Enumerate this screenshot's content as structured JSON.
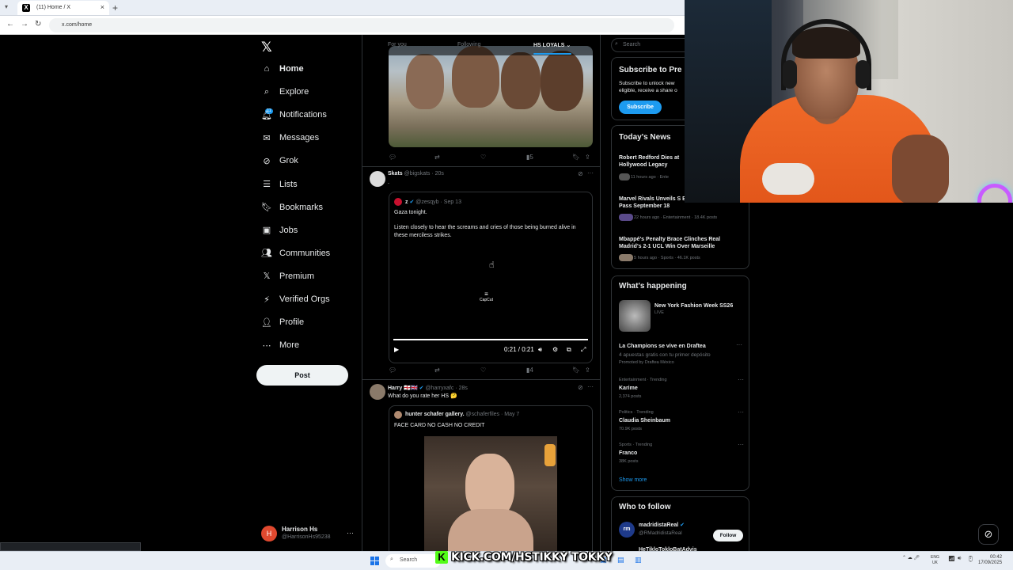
{
  "browser": {
    "tab_title": "(11) Home / X",
    "url": "x.com/home",
    "tab_close": "×",
    "new_tab": "+"
  },
  "nav": {
    "items": [
      {
        "label": "Home",
        "icon": "home-icon"
      },
      {
        "label": "Explore",
        "icon": "search-icon"
      },
      {
        "label": "Notifications",
        "icon": "bell-icon"
      },
      {
        "label": "Messages",
        "icon": "mail-icon"
      },
      {
        "label": "Grok",
        "icon": "grok-icon"
      },
      {
        "label": "Lists",
        "icon": "list-icon"
      },
      {
        "label": "Bookmarks",
        "icon": "bookmark-icon"
      },
      {
        "label": "Jobs",
        "icon": "briefcase-icon"
      },
      {
        "label": "Communities",
        "icon": "people-icon"
      },
      {
        "label": "Premium",
        "icon": "x-icon"
      },
      {
        "label": "Verified Orgs",
        "icon": "bolt-icon"
      },
      {
        "label": "Profile",
        "icon": "person-icon"
      },
      {
        "label": "More",
        "icon": "more-circle-icon"
      }
    ],
    "notif_count": "11",
    "post_label": "Post",
    "profile": {
      "name": "Harrison Hs",
      "handle": "@HarrisonHs95238",
      "initial": "H"
    }
  },
  "feed": {
    "tabs": [
      "For you",
      "Following",
      "HS LOYALS"
    ],
    "post1": {
      "reposts": "",
      "likes": "",
      "views": "5"
    },
    "post2": {
      "name": "Skats",
      "handle": "@bigskats · 20s",
      "text": ".",
      "quote": {
        "name": "z",
        "handle": "@zesqyb · Sep 13",
        "line1": "Gaza tonight.",
        "line2": "Listen closely to hear the screams and cries of those being burned alive in these merciless strikes."
      },
      "video": {
        "watermark": "CapCut",
        "time": "0:21 / 0:21"
      },
      "views": "4"
    },
    "post3": {
      "name": "Harry 🏴󠁧󠁢󠁥󠁮󠁧󠁿🇬🇧",
      "handle": "@harryxafc · 28s",
      "text": "What do you rate her HS 🤔",
      "quote": {
        "name": "hunter schafer gallery.",
        "handle": "@schaferfiles · May 7",
        "text": "FACE CARD NO CASH NO CREDIT"
      }
    }
  },
  "right": {
    "search_placeholder": "Search",
    "premium": {
      "title": "Subscribe to Pre",
      "line1": "Subscribe to unlock new",
      "line2": "eligible, receive a share o",
      "button": "Subscribe"
    },
    "news": {
      "title": "Today's News",
      "items": [
        {
          "headline": "Robert Redford Dies at Hollywood Legacy",
          "meta": "11 hours ago · Ente"
        },
        {
          "headline": "Marvel Rivals Unveils S Event Pass September 18",
          "meta": "22 hours ago · Entertainment · 18.4K posts"
        },
        {
          "headline": "Mbappé's Penalty Brace Clinches Real Madrid's 2-1 UCL Win Over Marseille",
          "meta": "5 hours ago · Sports · 46.1K posts"
        }
      ]
    },
    "happening": {
      "title": "What's happening",
      "event": {
        "name": "New York Fashion Week SS26",
        "status": "LIVE"
      },
      "promo": {
        "title": "La Champions se vive en Draftea",
        "sub": "4 apuestas gratis con tu primer depósito",
        "promoted": "Promoted by Draftea México"
      },
      "trends": [
        {
          "cat": "Entertainment · Trending",
          "name": "Karime",
          "count": "2,374 posts"
        },
        {
          "cat": "Politics · Trending",
          "name": "Claudia Sheinbaum",
          "count": "70.9K posts"
        },
        {
          "cat": "Sports · Trending",
          "name": "Franco",
          "count": "38K posts"
        }
      ],
      "show_more": "Show more"
    },
    "who": {
      "title": "Who to follow",
      "user": {
        "name": "madridistaReal",
        "handle": "@RMadridistaReal",
        "button": "Follow"
      },
      "user2": "HeTikloTokloBatAdvis"
    }
  },
  "taskbar": {
    "search": "Search",
    "banner": "KICK.COM/HSTIKKY TOKKY",
    "lang": "ENG\nUK",
    "time": "00:42",
    "date": "17/09/2025"
  },
  "colors": {
    "accent": "#1d9bf0",
    "kick": "#53fc18",
    "background": "#000000"
  }
}
